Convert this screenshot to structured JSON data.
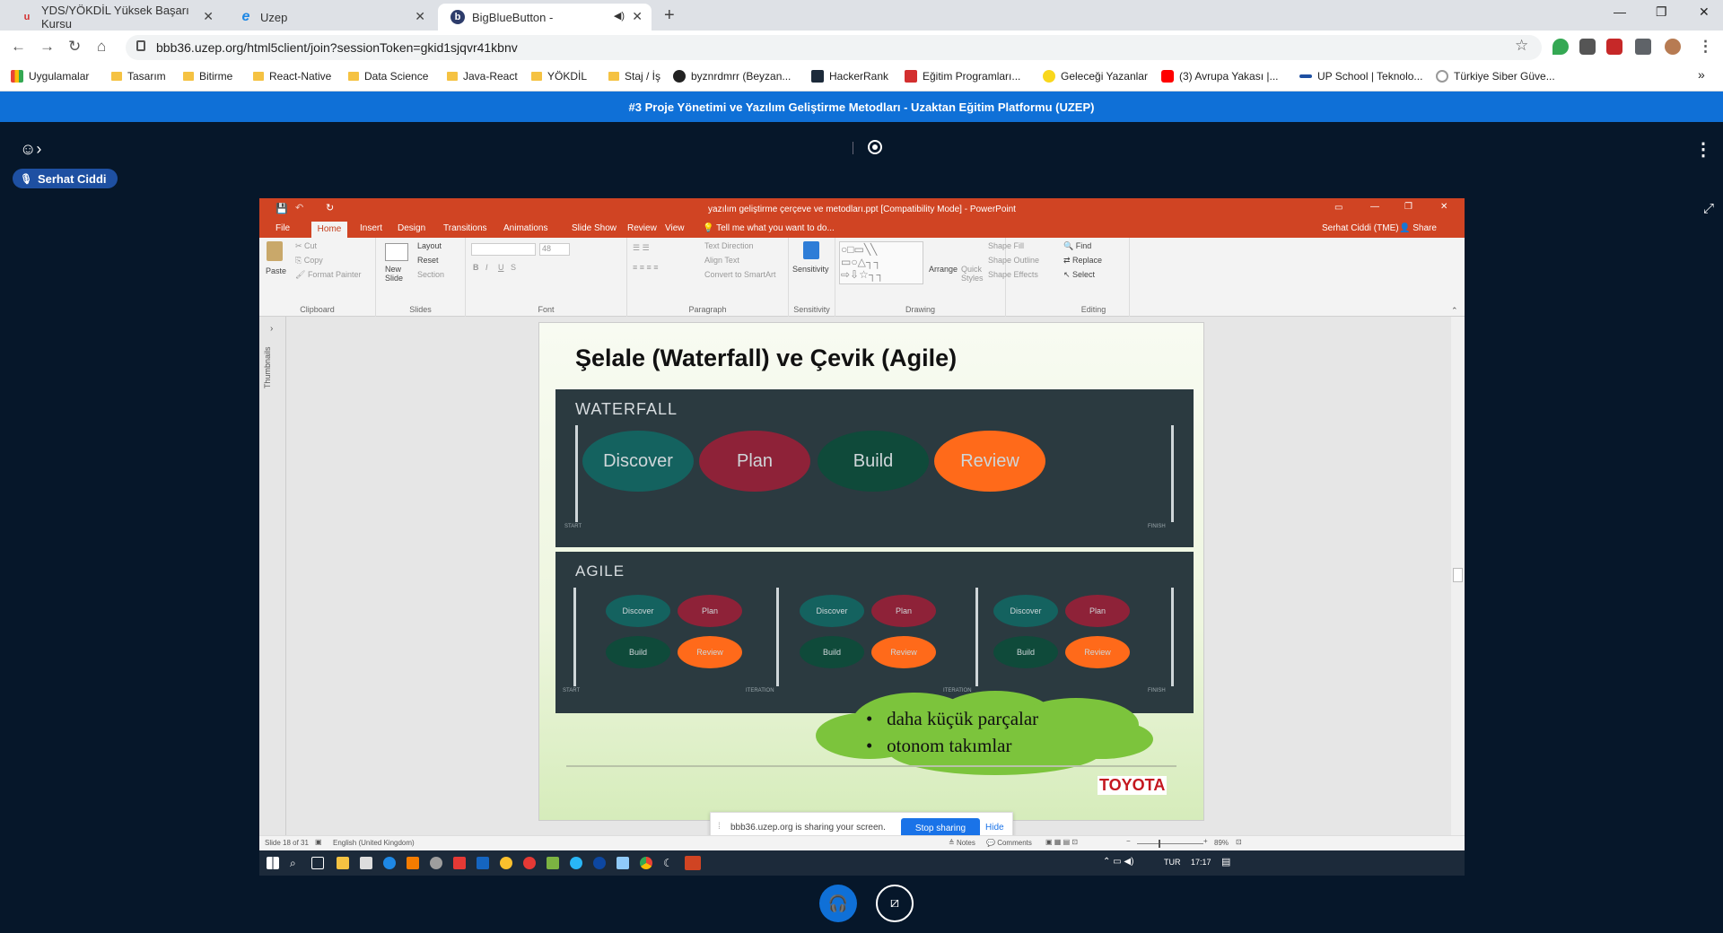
{
  "browser": {
    "tabs": [
      {
        "title": "YDS/YÖKDİL Yüksek Başarı Kursu",
        "favicon": "u-logo-icon",
        "active": false
      },
      {
        "title": "Uzep",
        "favicon": "edge-icon",
        "active": false
      },
      {
        "title": "BigBlueButton -",
        "favicon": "bbb-icon",
        "active": true
      }
    ],
    "new_tab": "+",
    "url": "bbb36.uzep.org/html5client/join?sessionToken=gkid1sjqvr41kbnv",
    "bookmarks": [
      "Uygulamalar",
      "Tasarım",
      "Bitirme",
      "React-Native",
      "Data Science",
      "Java-React",
      "YÖKDİL",
      "Staj / İş",
      "byznrdmrr (Beyzan...",
      "HackerRank",
      "Eğitim Programları...",
      "Geleceği Yazanlar",
      "(3) Avrupa Yakası |...",
      "UP School | Teknolo...",
      "Türkiye Siber Güve..."
    ],
    "more_bookmarks": "»"
  },
  "bbb": {
    "title": "#3 Proje Yönetimi ve Yazılım Geliştirme Metodları - Uzaktan Eğitim Platformu (UZEP)",
    "talker": "Serhat Ciddi"
  },
  "ppt": {
    "window_title": "yazılım geliştirme çerçeve ve metodları.ppt [Compatibility Mode] - PowerPoint",
    "tabs": [
      "File",
      "Home",
      "Insert",
      "Design",
      "Transitions",
      "Animations",
      "Slide Show",
      "Review",
      "View"
    ],
    "tell_me": "Tell me what you want to do...",
    "user": "Serhat Ciddi (TME)",
    "share": "Share",
    "ribbon": {
      "clipboard": {
        "label": "Clipboard",
        "paste": "Paste",
        "cut": "Cut",
        "copy": "Copy",
        "format_painter": "Format Painter"
      },
      "slides": {
        "label": "Slides",
        "new_slide": "New Slide",
        "layout": "Layout",
        "reset": "Reset",
        "section": "Section"
      },
      "font": {
        "label": "Font",
        "size": "48"
      },
      "paragraph": {
        "label": "Paragraph",
        "text_direction": "Text Direction",
        "align_text": "Align Text",
        "convert": "Convert to SmartArt"
      },
      "sensitivity": {
        "label": "Sensitivity",
        "button": "Sensitivity"
      },
      "drawing": {
        "label": "Drawing",
        "arrange": "Arrange",
        "quick_styles": "Quick Styles",
        "shape_fill": "Shape Fill",
        "shape_outline": "Shape Outline",
        "shape_effects": "Shape Effects"
      },
      "editing": {
        "label": "Editing",
        "find": "Find",
        "replace": "Replace",
        "select": "Select"
      }
    },
    "thumbnails": "Thumbnails",
    "slide": {
      "title": "Şelale (Waterfall) ve Çevik (Agile)",
      "waterfall": {
        "heading": "WATERFALL",
        "steps": [
          "Discover",
          "Plan",
          "Build",
          "Review"
        ],
        "start": "START",
        "finish": "FINISH"
      },
      "agile": {
        "heading": "AGILE",
        "steps": [
          "Discover",
          "Plan",
          "Build",
          "Review"
        ],
        "start": "START",
        "iteration": "ITERATION",
        "finish": "FINISH"
      },
      "bullets": [
        "daha küçük parçalar",
        "otonom takımlar"
      ],
      "logo": "TOYOTA"
    },
    "status": {
      "slide": "Slide 18 of 31",
      "language": "English (United Kingdom)",
      "notes": "Notes",
      "comments": "Comments",
      "zoom": "89%"
    },
    "taskbar": {
      "lang": "TUR",
      "time": "17:17"
    }
  },
  "share_notice": {
    "text": "bbb36.uzep.org is sharing your screen.",
    "stop": "Stop sharing",
    "hide": "Hide"
  },
  "colors": {
    "bbb_blue": "#0f70d7",
    "ppt_red": "#d04423",
    "teal": "#14625f",
    "crimson": "#8e2238",
    "green": "#0f4a3a",
    "orange": "#ff6a1a"
  }
}
